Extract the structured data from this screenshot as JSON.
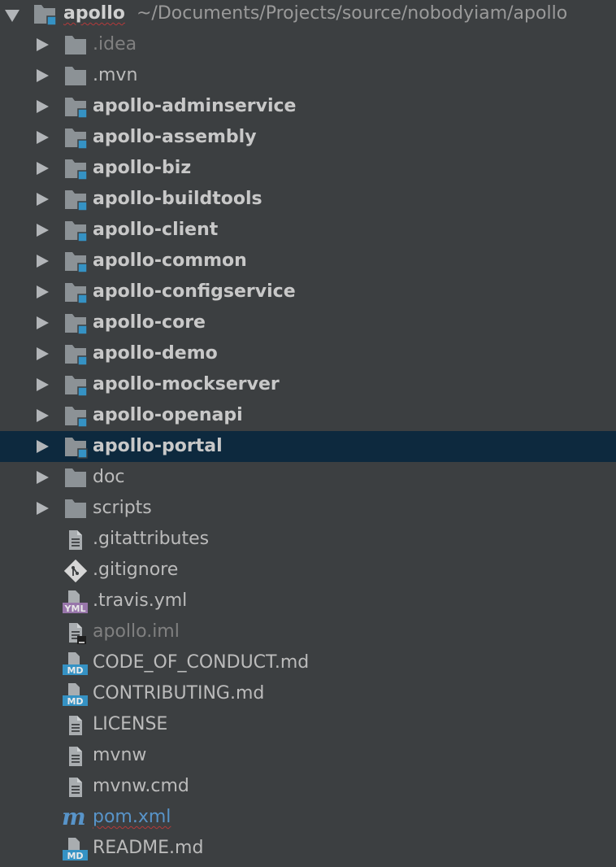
{
  "root": {
    "name": "apollo",
    "path": "~/Documents/Projects/source/nobodyiam/apollo"
  },
  "items": [
    {
      "label": ".idea",
      "type": "folder",
      "style": "dim",
      "expandable": true
    },
    {
      "label": ".mvn",
      "type": "folder",
      "style": "normal",
      "expandable": true
    },
    {
      "label": "apollo-adminservice",
      "type": "module",
      "style": "bold",
      "expandable": true
    },
    {
      "label": "apollo-assembly",
      "type": "module",
      "style": "bold",
      "expandable": true
    },
    {
      "label": "apollo-biz",
      "type": "module",
      "style": "bold",
      "expandable": true
    },
    {
      "label": "apollo-buildtools",
      "type": "module",
      "style": "bold",
      "expandable": true
    },
    {
      "label": "apollo-client",
      "type": "module",
      "style": "bold",
      "expandable": true
    },
    {
      "label": "apollo-common",
      "type": "module",
      "style": "bold",
      "expandable": true
    },
    {
      "label": "apollo-configservice",
      "type": "module",
      "style": "bold",
      "expandable": true
    },
    {
      "label": "apollo-core",
      "type": "module",
      "style": "bold",
      "expandable": true
    },
    {
      "label": "apollo-demo",
      "type": "module",
      "style": "bold",
      "expandable": true
    },
    {
      "label": "apollo-mockserver",
      "type": "module",
      "style": "bold",
      "expandable": true
    },
    {
      "label": "apollo-openapi",
      "type": "module",
      "style": "bold",
      "expandable": true
    },
    {
      "label": "apollo-portal",
      "type": "module",
      "style": "bold",
      "expandable": true,
      "selected": true
    },
    {
      "label": "doc",
      "type": "folder",
      "style": "normal",
      "expandable": true
    },
    {
      "label": "scripts",
      "type": "folder",
      "style": "normal",
      "expandable": true
    },
    {
      "label": ".gitattributes",
      "type": "text-file",
      "style": "normal",
      "expandable": false
    },
    {
      "label": ".gitignore",
      "type": "git-file",
      "style": "normal",
      "expandable": false
    },
    {
      "label": ".travis.yml",
      "type": "yml-file",
      "style": "normal",
      "expandable": false,
      "badge": "YML"
    },
    {
      "label": "apollo.iml",
      "type": "iml-file",
      "style": "dim",
      "expandable": false
    },
    {
      "label": "CODE_OF_CONDUCT.md",
      "type": "md-file",
      "style": "normal",
      "expandable": false,
      "badge": "MD"
    },
    {
      "label": "CONTRIBUTING.md",
      "type": "md-file",
      "style": "normal",
      "expandable": false,
      "badge": "MD"
    },
    {
      "label": "LICENSE",
      "type": "text-file",
      "style": "normal",
      "expandable": false
    },
    {
      "label": "mvnw",
      "type": "text-file",
      "style": "normal",
      "expandable": false
    },
    {
      "label": "mvnw.cmd",
      "type": "text-file",
      "style": "normal",
      "expandable": false
    },
    {
      "label": "pom.xml",
      "type": "maven-file",
      "style": "link",
      "expandable": false,
      "badge": "m"
    },
    {
      "label": "README.md",
      "type": "md-file",
      "style": "normal",
      "expandable": false,
      "badge": "MD"
    }
  ],
  "colors": {
    "background": "#3c3f41",
    "selection": "#0d293e",
    "folder": "#8c9296",
    "module_marker": "#3592c4",
    "md_badge": "#3592c4",
    "yml_badge": "#9876aa",
    "maven": "#5894c9"
  }
}
